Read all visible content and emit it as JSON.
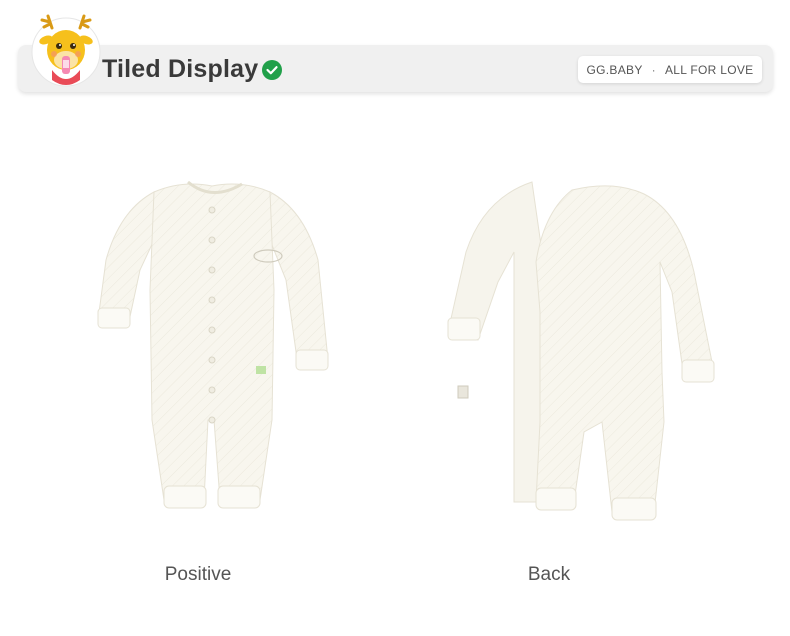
{
  "header": {
    "title": "Tiled Display",
    "brand": "GG.BABY",
    "separator": "·",
    "slogan": "ALL FOR LOVE"
  },
  "products": [
    {
      "caption": "Positive"
    },
    {
      "caption": "Back"
    }
  ],
  "colors": {
    "header_bg": "#f0f0f0",
    "check_green": "#21a04a",
    "garment": "#f8f6ee",
    "mascot_yellow": "#f6c01c"
  }
}
